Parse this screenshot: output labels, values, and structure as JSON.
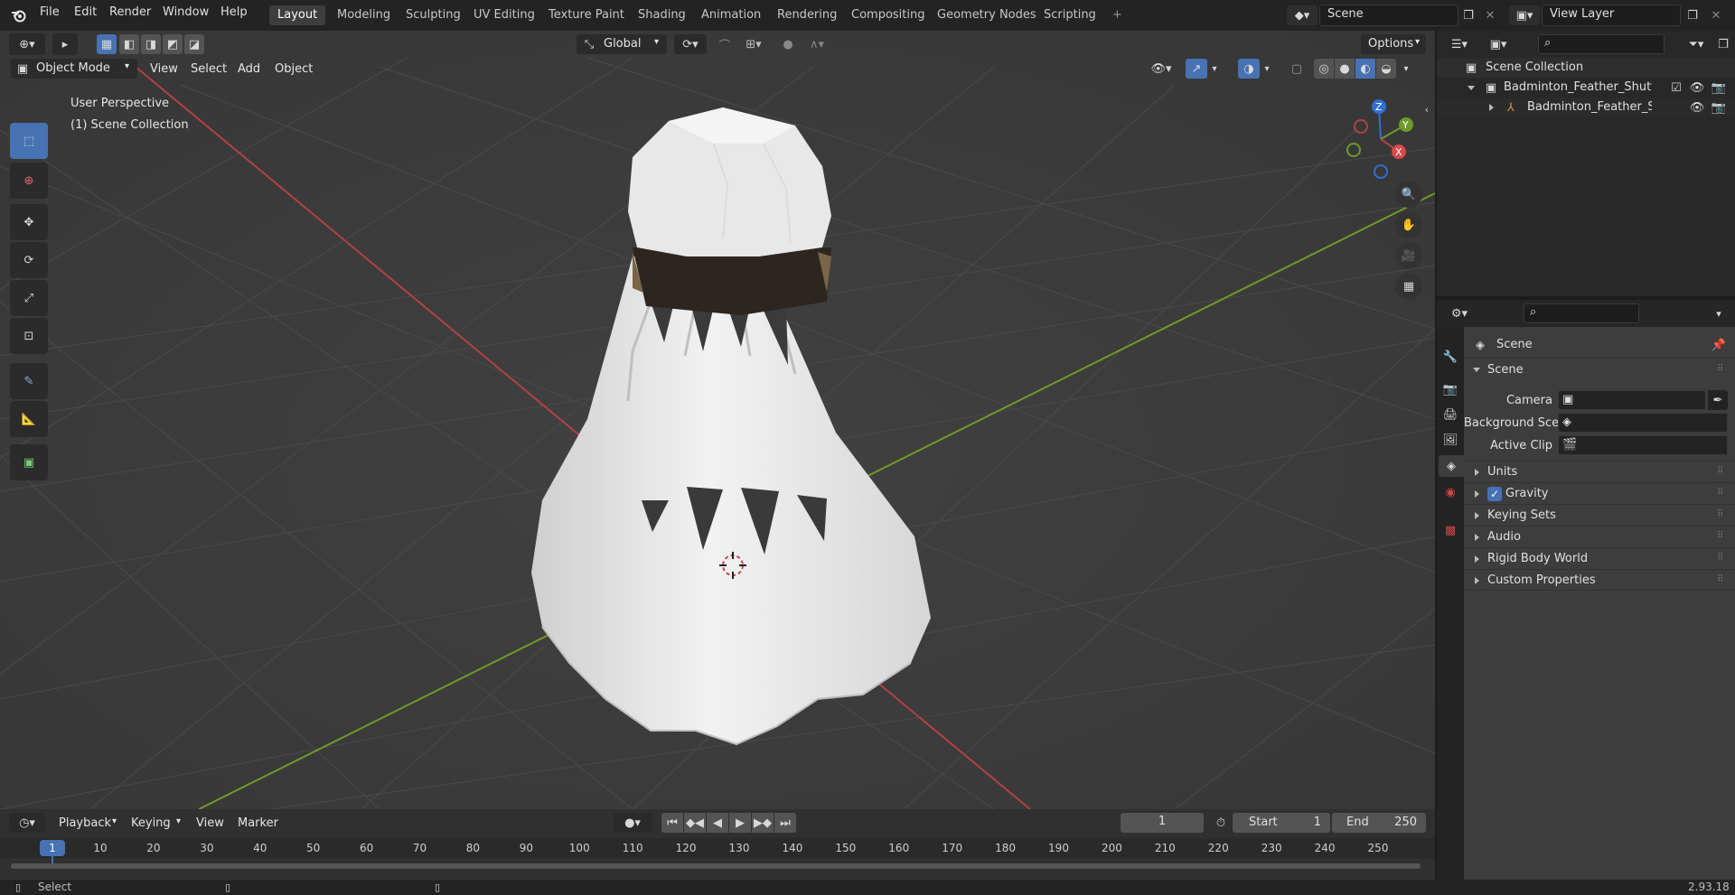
{
  "menus": [
    "File",
    "Edit",
    "Render",
    "Window",
    "Help"
  ],
  "workspaces": [
    "Layout",
    "Modeling",
    "Sculpting",
    "UV Editing",
    "Texture Paint",
    "Shading",
    "Animation",
    "Rendering",
    "Compositing",
    "Geometry Nodes",
    "Scripting"
  ],
  "active_workspace": "Layout",
  "add_workspace": "+",
  "scene_field": "Scene",
  "view_layer_field": "View Layer",
  "toolbar": {
    "transform_orientation": "Global",
    "options_label": "Options"
  },
  "viewport_header": {
    "mode": "Object Mode",
    "menus": [
      "View",
      "Select",
      "Add",
      "Object"
    ]
  },
  "viewport_overlay": {
    "perspective": "User Perspective",
    "collection": "(1) Scene Collection"
  },
  "gizmo": {
    "z": "Z",
    "y": "Y",
    "x": "X"
  },
  "outliner": {
    "root": "Scene Collection",
    "items": [
      {
        "label": "Badminton_Feather_Shuttlec"
      },
      {
        "label": "Badminton_Feather_Shu"
      }
    ]
  },
  "properties": {
    "context": "Scene",
    "panel": "Scene",
    "fields": [
      {
        "label": "Camera"
      },
      {
        "label": "Background Scene"
      },
      {
        "label": "Active Clip"
      }
    ],
    "subpanels": [
      "Units",
      "Gravity",
      "Keying Sets",
      "Audio",
      "Rigid Body World",
      "Custom Properties"
    ],
    "gravity_checked": true
  },
  "timeline": {
    "menus": [
      "Playback",
      "Keying",
      "View",
      "Marker"
    ],
    "current_frame": "1",
    "start_label": "Start",
    "start_value": "1",
    "end_label": "End",
    "end_value": "250",
    "ruler_marks": [
      "1",
      "10",
      "20",
      "30",
      "40",
      "50",
      "60",
      "70",
      "80",
      "90",
      "100",
      "110",
      "120",
      "130",
      "140",
      "150",
      "160",
      "170",
      "180",
      "190",
      "200",
      "210",
      "220",
      "230",
      "240",
      "250"
    ]
  },
  "statusbar": {
    "left": "Select",
    "version": "2.93.18"
  },
  "colors": {
    "accent": "#4772b3",
    "x_axis": "#b34242",
    "y_axis": "#6f9a2a",
    "z_axis": "#2f6fd6"
  }
}
